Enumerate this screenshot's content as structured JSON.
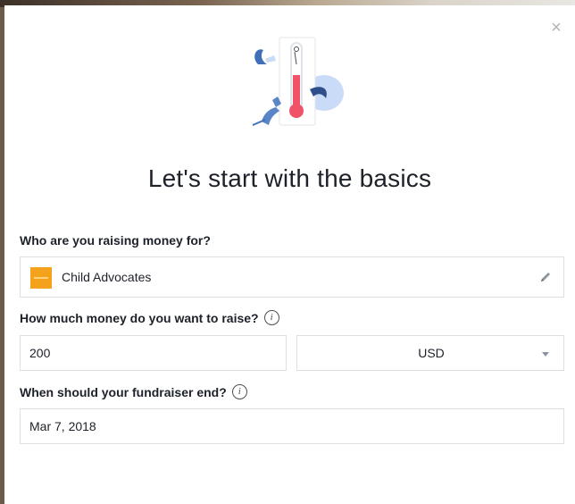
{
  "dialog": {
    "close_label": "×",
    "title": "Let's start with the basics"
  },
  "beneficiary": {
    "label": "Who are you raising money for?",
    "name": "Child Advocates",
    "logo_color": "#f4a11c"
  },
  "goal": {
    "label": "How much money do you want to raise?",
    "amount": "200",
    "currency": "USD"
  },
  "end_date": {
    "label": "When should your fundraiser end?",
    "value": "Mar 7, 2018"
  },
  "icons": {
    "close": "close-icon",
    "info": "info-icon",
    "edit": "pencil-icon",
    "dropdown": "chevron-down-icon",
    "illustration": "thermometer-illustration"
  },
  "colors": {
    "thermometer": "#f25268",
    "illustration_blue": "#3f6fb8",
    "accent_light_blue": "#c9dbf6"
  }
}
